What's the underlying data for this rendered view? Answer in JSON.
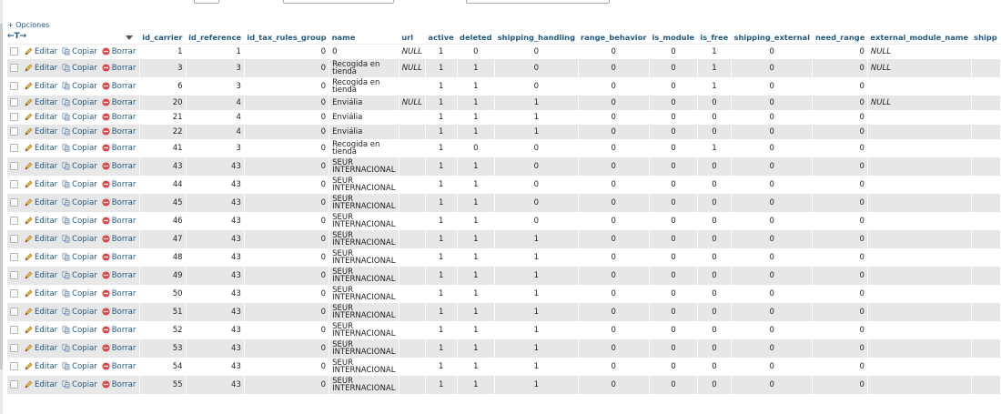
{
  "options_label": "+ Opciones",
  "nav_arrows": "←T→",
  "actions": {
    "edit": "Editar",
    "copy": "Copiar",
    "delete": "Borrar"
  },
  "columns": [
    "id_carrier",
    "id_reference",
    "id_tax_rules_group",
    "name",
    "url",
    "active",
    "deleted",
    "shipping_handling",
    "range_behavior",
    "is_module",
    "is_free",
    "shipping_external",
    "need_range",
    "external_module_name",
    "shipp"
  ],
  "rows": [
    {
      "id_carrier": "1",
      "id_reference": "1",
      "id_tax": "0",
      "name": "0",
      "url": "NULL",
      "active": "1",
      "deleted": "0",
      "shipping_handling": "0",
      "range_behavior": "0",
      "is_module": "0",
      "is_free": "1",
      "shipping_external": "0",
      "need_range": "0",
      "module_name": "NULL"
    },
    {
      "id_carrier": "3",
      "id_reference": "3",
      "id_tax": "0",
      "name": "Recogida en tienda",
      "url": "NULL",
      "active": "1",
      "deleted": "1",
      "shipping_handling": "0",
      "range_behavior": "0",
      "is_module": "0",
      "is_free": "1",
      "shipping_external": "0",
      "need_range": "0",
      "module_name": "NULL"
    },
    {
      "id_carrier": "6",
      "id_reference": "3",
      "id_tax": "0",
      "name": "Recogida en tienda",
      "url": "",
      "active": "1",
      "deleted": "1",
      "shipping_handling": "0",
      "range_behavior": "0",
      "is_module": "0",
      "is_free": "1",
      "shipping_external": "0",
      "need_range": "0",
      "module_name": ""
    },
    {
      "id_carrier": "20",
      "id_reference": "4",
      "id_tax": "0",
      "name": "Enviália",
      "url": "NULL",
      "active": "1",
      "deleted": "1",
      "shipping_handling": "1",
      "range_behavior": "0",
      "is_module": "0",
      "is_free": "0",
      "shipping_external": "0",
      "need_range": "0",
      "module_name": "NULL"
    },
    {
      "id_carrier": "21",
      "id_reference": "4",
      "id_tax": "0",
      "name": "Enviália",
      "url": "",
      "active": "1",
      "deleted": "1",
      "shipping_handling": "1",
      "range_behavior": "0",
      "is_module": "0",
      "is_free": "0",
      "shipping_external": "0",
      "need_range": "0",
      "module_name": ""
    },
    {
      "id_carrier": "22",
      "id_reference": "4",
      "id_tax": "0",
      "name": "Enviália",
      "url": "",
      "active": "1",
      "deleted": "1",
      "shipping_handling": "1",
      "range_behavior": "0",
      "is_module": "0",
      "is_free": "0",
      "shipping_external": "0",
      "need_range": "0",
      "module_name": ""
    },
    {
      "id_carrier": "41",
      "id_reference": "3",
      "id_tax": "0",
      "name": "Recogida en tienda",
      "url": "",
      "active": "1",
      "deleted": "0",
      "shipping_handling": "0",
      "range_behavior": "0",
      "is_module": "0",
      "is_free": "1",
      "shipping_external": "0",
      "need_range": "0",
      "module_name": ""
    },
    {
      "id_carrier": "43",
      "id_reference": "43",
      "id_tax": "0",
      "name": "SEUR INTERNACIONAL",
      "url": "",
      "active": "1",
      "deleted": "1",
      "shipping_handling": "0",
      "range_behavior": "0",
      "is_module": "0",
      "is_free": "0",
      "shipping_external": "0",
      "need_range": "0",
      "module_name": ""
    },
    {
      "id_carrier": "44",
      "id_reference": "43",
      "id_tax": "0",
      "name": "SEUR INTERNACIONAL",
      "url": "",
      "active": "1",
      "deleted": "1",
      "shipping_handling": "0",
      "range_behavior": "0",
      "is_module": "0",
      "is_free": "0",
      "shipping_external": "0",
      "need_range": "0",
      "module_name": ""
    },
    {
      "id_carrier": "45",
      "id_reference": "43",
      "id_tax": "0",
      "name": "SEUR INTERNACIONAL",
      "url": "",
      "active": "1",
      "deleted": "1",
      "shipping_handling": "0",
      "range_behavior": "0",
      "is_module": "0",
      "is_free": "0",
      "shipping_external": "0",
      "need_range": "0",
      "module_name": ""
    },
    {
      "id_carrier": "46",
      "id_reference": "43",
      "id_tax": "0",
      "name": "SEUR INTERNACIONAL",
      "url": "",
      "active": "1",
      "deleted": "1",
      "shipping_handling": "0",
      "range_behavior": "0",
      "is_module": "0",
      "is_free": "0",
      "shipping_external": "0",
      "need_range": "0",
      "module_name": ""
    },
    {
      "id_carrier": "47",
      "id_reference": "43",
      "id_tax": "0",
      "name": "SEUR INTERNACIONAL",
      "url": "",
      "active": "1",
      "deleted": "1",
      "shipping_handling": "1",
      "range_behavior": "0",
      "is_module": "0",
      "is_free": "0",
      "shipping_external": "0",
      "need_range": "0",
      "module_name": ""
    },
    {
      "id_carrier": "48",
      "id_reference": "43",
      "id_tax": "0",
      "name": "SEUR INTERNACIONAL",
      "url": "",
      "active": "1",
      "deleted": "1",
      "shipping_handling": "1",
      "range_behavior": "0",
      "is_module": "0",
      "is_free": "0",
      "shipping_external": "0",
      "need_range": "0",
      "module_name": ""
    },
    {
      "id_carrier": "49",
      "id_reference": "43",
      "id_tax": "0",
      "name": "SEUR INTERNACIONAL",
      "url": "",
      "active": "1",
      "deleted": "1",
      "shipping_handling": "1",
      "range_behavior": "0",
      "is_module": "0",
      "is_free": "0",
      "shipping_external": "0",
      "need_range": "0",
      "module_name": ""
    },
    {
      "id_carrier": "50",
      "id_reference": "43",
      "id_tax": "0",
      "name": "SEUR INTERNACIONAL",
      "url": "",
      "active": "1",
      "deleted": "1",
      "shipping_handling": "1",
      "range_behavior": "0",
      "is_module": "0",
      "is_free": "0",
      "shipping_external": "0",
      "need_range": "0",
      "module_name": ""
    },
    {
      "id_carrier": "51",
      "id_reference": "43",
      "id_tax": "0",
      "name": "SEUR INTERNACIONAL",
      "url": "",
      "active": "1",
      "deleted": "1",
      "shipping_handling": "1",
      "range_behavior": "0",
      "is_module": "0",
      "is_free": "0",
      "shipping_external": "0",
      "need_range": "0",
      "module_name": ""
    },
    {
      "id_carrier": "52",
      "id_reference": "43",
      "id_tax": "0",
      "name": "SEUR INTERNACIONAL",
      "url": "",
      "active": "1",
      "deleted": "1",
      "shipping_handling": "1",
      "range_behavior": "0",
      "is_module": "0",
      "is_free": "0",
      "shipping_external": "0",
      "need_range": "0",
      "module_name": ""
    },
    {
      "id_carrier": "53",
      "id_reference": "43",
      "id_tax": "0",
      "name": "SEUR INTERNACIONAL",
      "url": "",
      "active": "1",
      "deleted": "1",
      "shipping_handling": "1",
      "range_behavior": "0",
      "is_module": "0",
      "is_free": "0",
      "shipping_external": "0",
      "need_range": "0",
      "module_name": ""
    },
    {
      "id_carrier": "54",
      "id_reference": "43",
      "id_tax": "0",
      "name": "SEUR INTERNACIONAL",
      "url": "",
      "active": "1",
      "deleted": "1",
      "shipping_handling": "1",
      "range_behavior": "0",
      "is_module": "0",
      "is_free": "0",
      "shipping_external": "0",
      "need_range": "0",
      "module_name": ""
    },
    {
      "id_carrier": "55",
      "id_reference": "43",
      "id_tax": "0",
      "name": "SEUR INTERNACIONAL",
      "url": "",
      "active": "1",
      "deleted": "1",
      "shipping_handling": "1",
      "range_behavior": "0",
      "is_module": "0",
      "is_free": "0",
      "shipping_external": "0",
      "need_range": "0",
      "module_name": ""
    }
  ]
}
